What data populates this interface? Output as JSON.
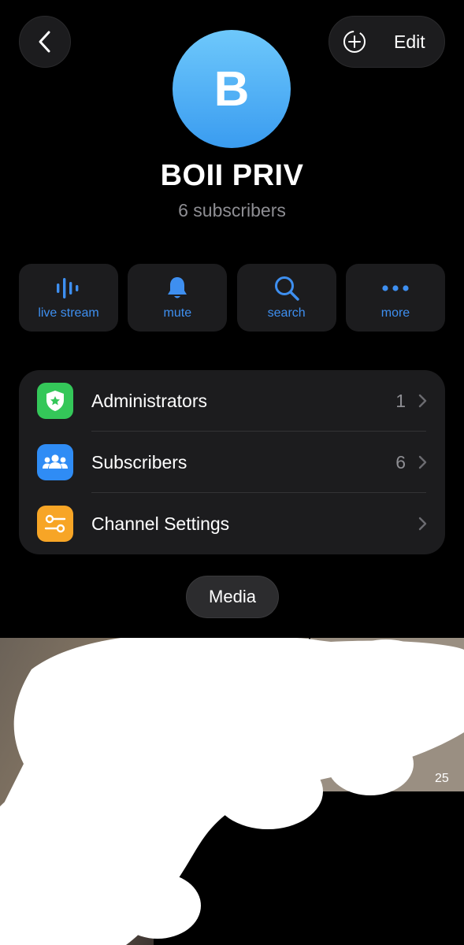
{
  "header": {
    "edit_label": "Edit"
  },
  "channel": {
    "avatar_letter": "B",
    "name": "BOII PRIV",
    "subscribers_text": "6 subscribers"
  },
  "actions": [
    {
      "label": "live stream",
      "icon": "live-stream-icon"
    },
    {
      "label": "mute",
      "icon": "bell-icon"
    },
    {
      "label": "search",
      "icon": "search-icon"
    },
    {
      "label": "more",
      "icon": "more-icon"
    }
  ],
  "menu": [
    {
      "label": "Administrators",
      "count": "1",
      "icon": "shield-star-icon",
      "color": "#34c759"
    },
    {
      "label": "Subscribers",
      "count": "6",
      "icon": "people-icon",
      "color": "#2f8cf5"
    },
    {
      "label": "Channel Settings",
      "count": "",
      "icon": "settings-sliders-icon",
      "color": "#f7a526"
    }
  ],
  "media": {
    "tab_label": "Media",
    "duration_badge": "25"
  },
  "colors": {
    "accent": "#3e8ff0",
    "background": "#000000",
    "card": "#1c1c1e"
  }
}
